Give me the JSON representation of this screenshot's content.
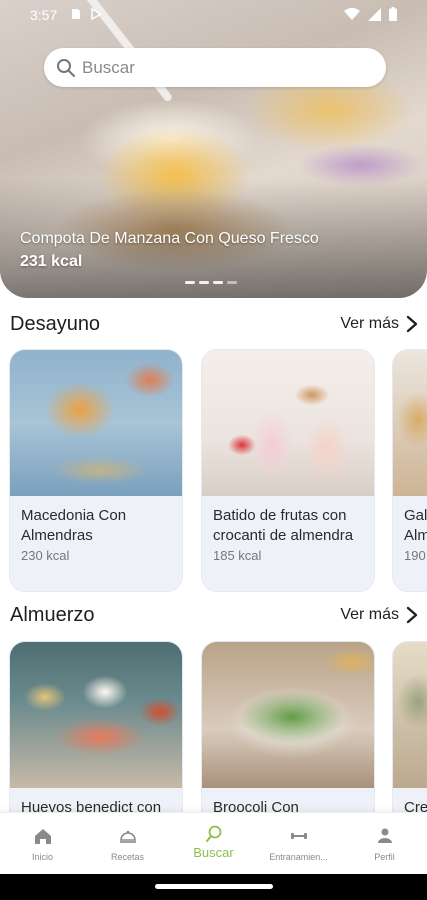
{
  "status_bar": {
    "time": "3:57"
  },
  "search": {
    "placeholder": "Buscar"
  },
  "hero": {
    "title": "Compota De Manzana Con Queso Fresco",
    "kcal": "231 kcal",
    "slides": 4,
    "active_slide": 3
  },
  "sections": [
    {
      "title": "Desayuno",
      "see_more": "Ver más",
      "items": [
        {
          "name": "Macedonia Con Almendras",
          "kcal": "230 kcal"
        },
        {
          "name": "Batido de frutas con crocanti de almendra",
          "kcal": "185 kcal"
        },
        {
          "name": "Gal Alm",
          "kcal": "190"
        }
      ]
    },
    {
      "title": "Almuerzo",
      "see_more": "Ver más",
      "items": [
        {
          "name": "Huevos benedict con",
          "kcal": ""
        },
        {
          "name": "Broocoli Con",
          "kcal": ""
        },
        {
          "name": "Cre",
          "kcal": ""
        }
      ]
    }
  ],
  "bottom_nav": [
    {
      "label": "Inicio",
      "icon": "home-icon"
    },
    {
      "label": "Recetas",
      "icon": "cloche-icon"
    },
    {
      "label": "Buscar",
      "icon": "search-icon",
      "active": true
    },
    {
      "label": "Entranamien...",
      "icon": "dumbbell-icon"
    },
    {
      "label": "Perfil",
      "icon": "person-icon"
    }
  ],
  "colors": {
    "accent": "#8dbf4c",
    "card_bg": "#eef2f8",
    "text": "#222222"
  }
}
